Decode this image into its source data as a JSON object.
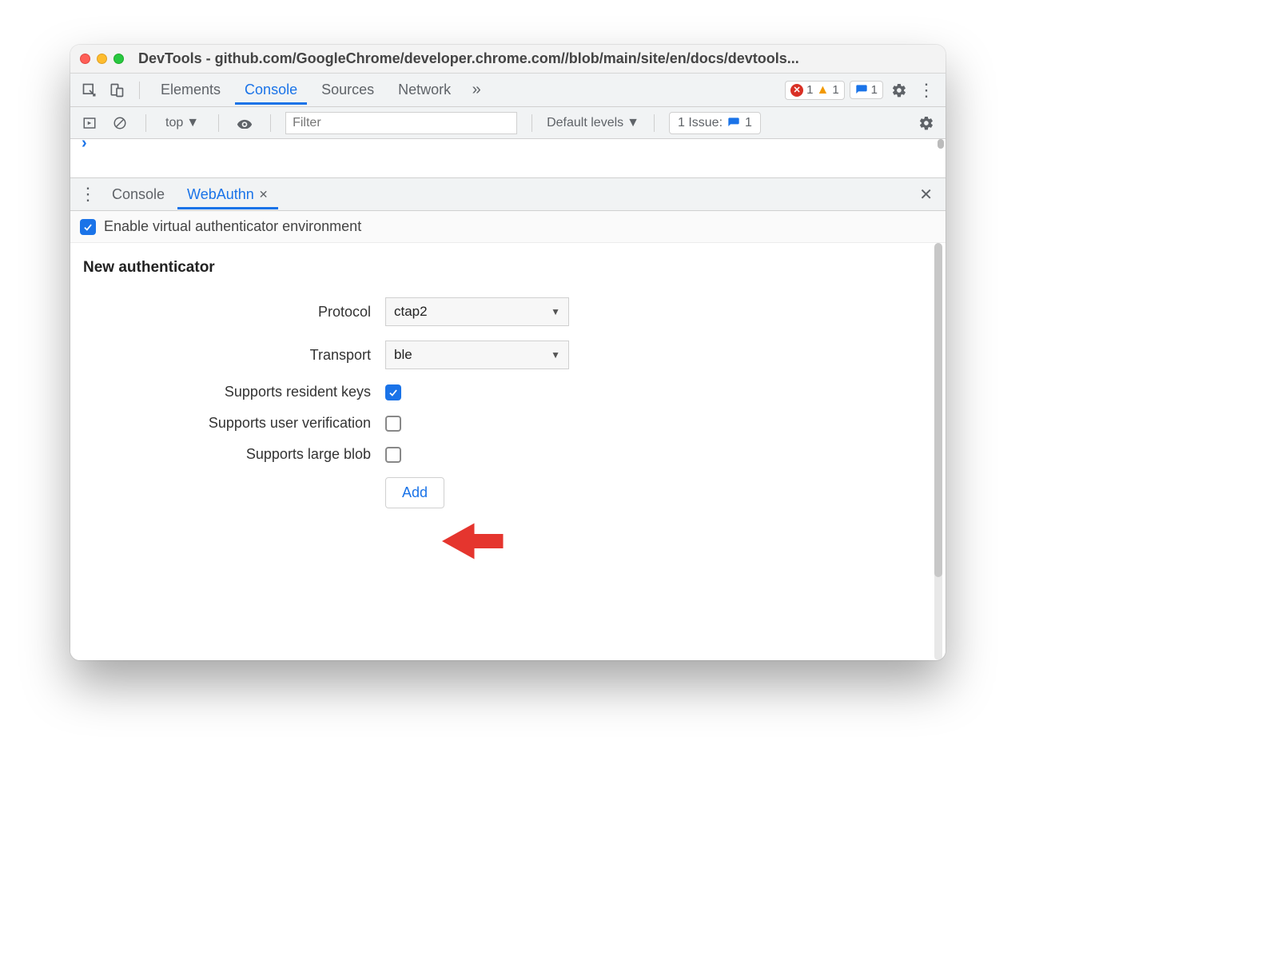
{
  "window": {
    "title": "DevTools - github.com/GoogleChrome/developer.chrome.com//blob/main/site/en/docs/devtools..."
  },
  "main_tabs": {
    "items": [
      "Elements",
      "Console",
      "Sources",
      "Network"
    ],
    "active": "Console",
    "error_count": "1",
    "warn_count": "1",
    "issue_count": "1"
  },
  "console_toolbar": {
    "context": "top",
    "filter_placeholder": "Filter",
    "levels_label": "Default levels",
    "issues_label": "1 Issue:",
    "issues_count": "1"
  },
  "drawer": {
    "tabs": [
      "Console",
      "WebAuthn"
    ],
    "active": "WebAuthn"
  },
  "webauthn": {
    "enable_label": "Enable virtual authenticator environment",
    "enable_checked": true,
    "section_title": "New authenticator",
    "rows": {
      "protocol_label": "Protocol",
      "protocol_value": "ctap2",
      "transport_label": "Transport",
      "transport_value": "ble",
      "resident_label": "Supports resident keys",
      "resident_checked": true,
      "userverif_label": "Supports user verification",
      "userverif_checked": false,
      "largeblob_label": "Supports large blob",
      "largeblob_checked": false
    },
    "add_button": "Add"
  }
}
